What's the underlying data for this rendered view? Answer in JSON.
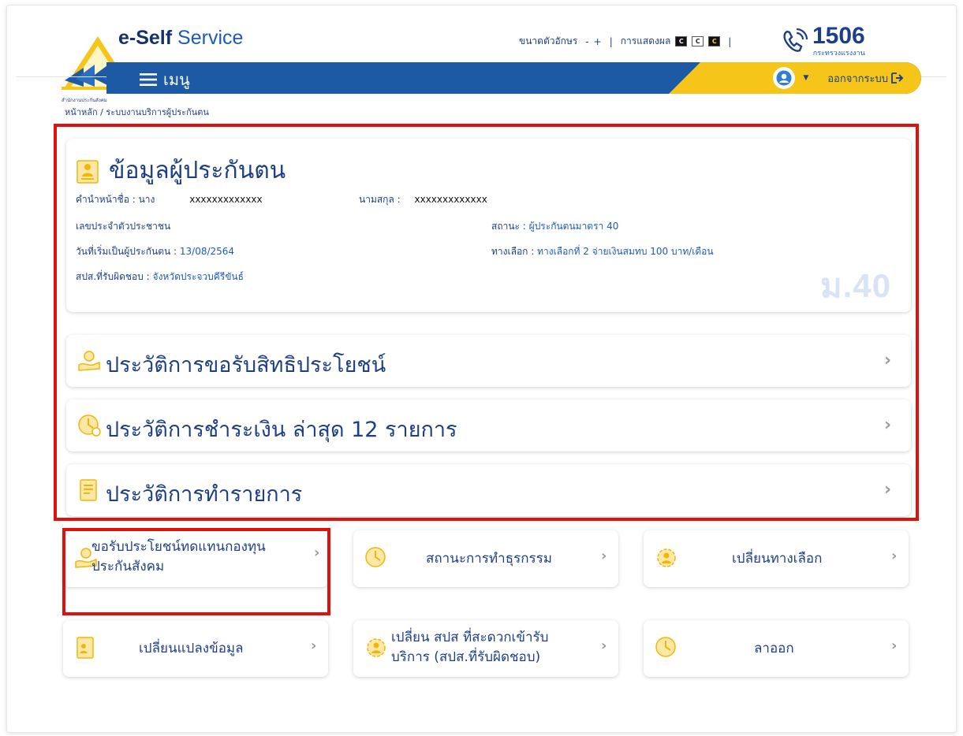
{
  "header": {
    "brand_bold": "e-Self",
    "brand_rest": " Service",
    "font_size_label": "ขนาดตัวอักษร",
    "font_minus": "-",
    "font_plus": "+",
    "display_label": "การแสดงผล",
    "swatch_1": "C",
    "swatch_2": "C",
    "swatch_3": "C",
    "hotline": "1506",
    "hotline_sub": "กระทรวงแรงงาน",
    "logo_caption": "สำนักงานประกันสังคม"
  },
  "nav": {
    "menu_label": "เมนู",
    "logout_label": "ออกจากระบบ"
  },
  "breadcrumb": "หน้าหลัก / ระบบงานบริการผู้ประกันตน",
  "info": {
    "title": "ข้อมูลผู้ประกันตน",
    "prefix_label": "คำนำหน้าชื่อ : นาง",
    "first_name": "xxxxxxxxxxxxx",
    "surname_label": "นามสกุล :",
    "surname": "xxxxxxxxxxxxx",
    "citizen_id_label": "เลขประจำตัวประชาชน",
    "status_label": "สถานะ : ",
    "status_value": "ผู้ประกันตนมาตรา 40",
    "start_date_label": "วันที่เริ่มเป็นผู้ประกันตน : ",
    "start_date_value": "13/08/2564",
    "option_label": "ทางเลือก : ",
    "option_value": "ทางเลือกที่ 2 จ่ายเงินสมทบ 100 บาท/เดือน",
    "office_label": "สปส.ที่รับผิดชอบ : ",
    "office_value": "จังหวัดประจวบคีรีขันธ์",
    "watermark": "ม.40"
  },
  "history": [
    {
      "label": "ประวัติการขอรับสิทธิประโยชน์"
    },
    {
      "label": "ประวัติการชำระเงิน ล่าสุด 12 รายการ"
    },
    {
      "label": "ประวัติการทำรายการ"
    }
  ],
  "tiles": [
    {
      "label": "ขอรับประโยชน์ทดแทนกองทุนประกันสังคม",
      "line1": "ขอรับประโยชน์ทดแทนกองทุน",
      "line2": "ประกันสังคม"
    },
    {
      "label": "สถานะการทำธุรกรรม"
    },
    {
      "label": "เปลี่ยนทางเลือก"
    },
    {
      "label": "เปลี่ยนแปลงข้อมูล"
    },
    {
      "label": "เปลี่ยน สปส ที่สะดวกเข้ารับบริการ (สปส.ที่รับผิดชอบ)",
      "line1": "เปลี่ยน สปส ที่สะดวกเข้ารับ",
      "line2": "บริการ (สปส.ที่รับผิดชอบ)"
    },
    {
      "label": "ลาออก"
    }
  ],
  "colors": {
    "navy": "#1d3f8a",
    "nav_blue": "#1c5aa6",
    "yellow": "#f6c519",
    "highlight_red": "#e0100a"
  }
}
